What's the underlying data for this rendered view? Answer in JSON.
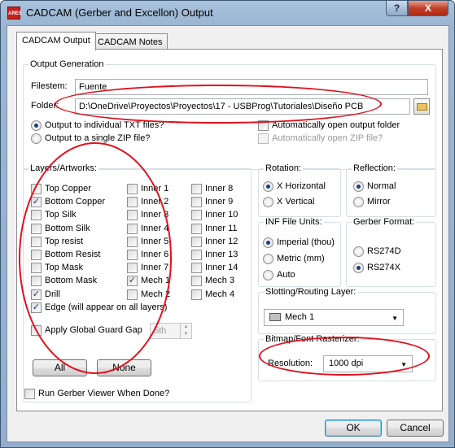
{
  "window": {
    "title": "CADCAM (Gerber and Excellon) Output",
    "app_icon_text": "ARES",
    "help_glyph": "?",
    "close_glyph": "X"
  },
  "tabs": [
    {
      "label": "CADCAM Output",
      "active": true
    },
    {
      "label": "CADCAM Notes",
      "active": false
    }
  ],
  "output_generation": {
    "title": "Output Generation",
    "filestem_label": "Filestem:",
    "filestem_value": "Fuente",
    "folder_label": "Folder:",
    "folder_value": "D:\\OneDrive\\Proyectos\\Proyectos\\17 - USBProg\\Tutoriales\\Diseño PCB",
    "output_individual": "Output to individual TXT files?",
    "output_zip": "Output to a single ZIP file?",
    "auto_open_folder": "Automatically open output folder",
    "auto_open_zip": "Automatically open ZIP file?"
  },
  "layers": {
    "title": "Layers/Artworks:",
    "col1": [
      {
        "label": "Top Copper",
        "checked": false
      },
      {
        "label": "Bottom Copper",
        "checked": true
      },
      {
        "label": "Top Silk",
        "checked": false
      },
      {
        "label": "Bottom Silk",
        "checked": false
      },
      {
        "label": "Top resist",
        "checked": false
      },
      {
        "label": "Bottom Resist",
        "checked": false
      },
      {
        "label": "Top Mask",
        "checked": false
      },
      {
        "label": "Bottom Mask",
        "checked": false
      },
      {
        "label": "Drill",
        "checked": true
      },
      {
        "label": "Edge (will appear on all layers)",
        "checked": true
      }
    ],
    "col2": [
      {
        "label": "Inner 1",
        "checked": false
      },
      {
        "label": "Inner 2",
        "checked": false
      },
      {
        "label": "Inner 3",
        "checked": false
      },
      {
        "label": "Inner 4",
        "checked": false
      },
      {
        "label": "Inner 5",
        "checked": false
      },
      {
        "label": "Inner 6",
        "checked": false
      },
      {
        "label": "Inner 7",
        "checked": false
      },
      {
        "label": "Mech 1",
        "checked": true
      },
      {
        "label": "Mech 2",
        "checked": false
      }
    ],
    "col3": [
      {
        "label": "Inner 8",
        "checked": false
      },
      {
        "label": "Inner 9",
        "checked": false
      },
      {
        "label": "Inner 10",
        "checked": false
      },
      {
        "label": "Inner 11",
        "checked": false
      },
      {
        "label": "Inner 12",
        "checked": false
      },
      {
        "label": "Inner 13",
        "checked": false
      },
      {
        "label": "Inner 14",
        "checked": false
      },
      {
        "label": "Mech 3",
        "checked": false
      },
      {
        "label": "Mech 4",
        "checked": false
      }
    ],
    "guard_gap_label": "Apply Global Guard Gap",
    "guard_gap_value": "5th",
    "all_button": "All",
    "none_button": "None"
  },
  "rotation": {
    "title": "Rotation:",
    "horizontal": "X Horizontal",
    "vertical": "X Vertical"
  },
  "reflection": {
    "title": "Reflection:",
    "normal": "Normal",
    "mirror": "Mirror"
  },
  "inf_units": {
    "title": "INF File Units:",
    "imperial": "Imperial (thou)",
    "metric": "Metric (mm)",
    "auto": "Auto"
  },
  "gerber_format": {
    "title": "Gerber Format:",
    "rs274d": "RS274D",
    "rs274x": "RS274X"
  },
  "slotting": {
    "title": "Slotting/Routing Layer:",
    "value": "Mech 1"
  },
  "bitmap": {
    "title": "Bitmap/Font Rasterizer:",
    "resolution_label": "Resolution:",
    "resolution_value": "1000 dpi"
  },
  "run_viewer_label": "Run Gerber Viewer When Done?",
  "ok_button": "OK",
  "cancel_button": "Cancel",
  "annotation_color": "#e1101c"
}
